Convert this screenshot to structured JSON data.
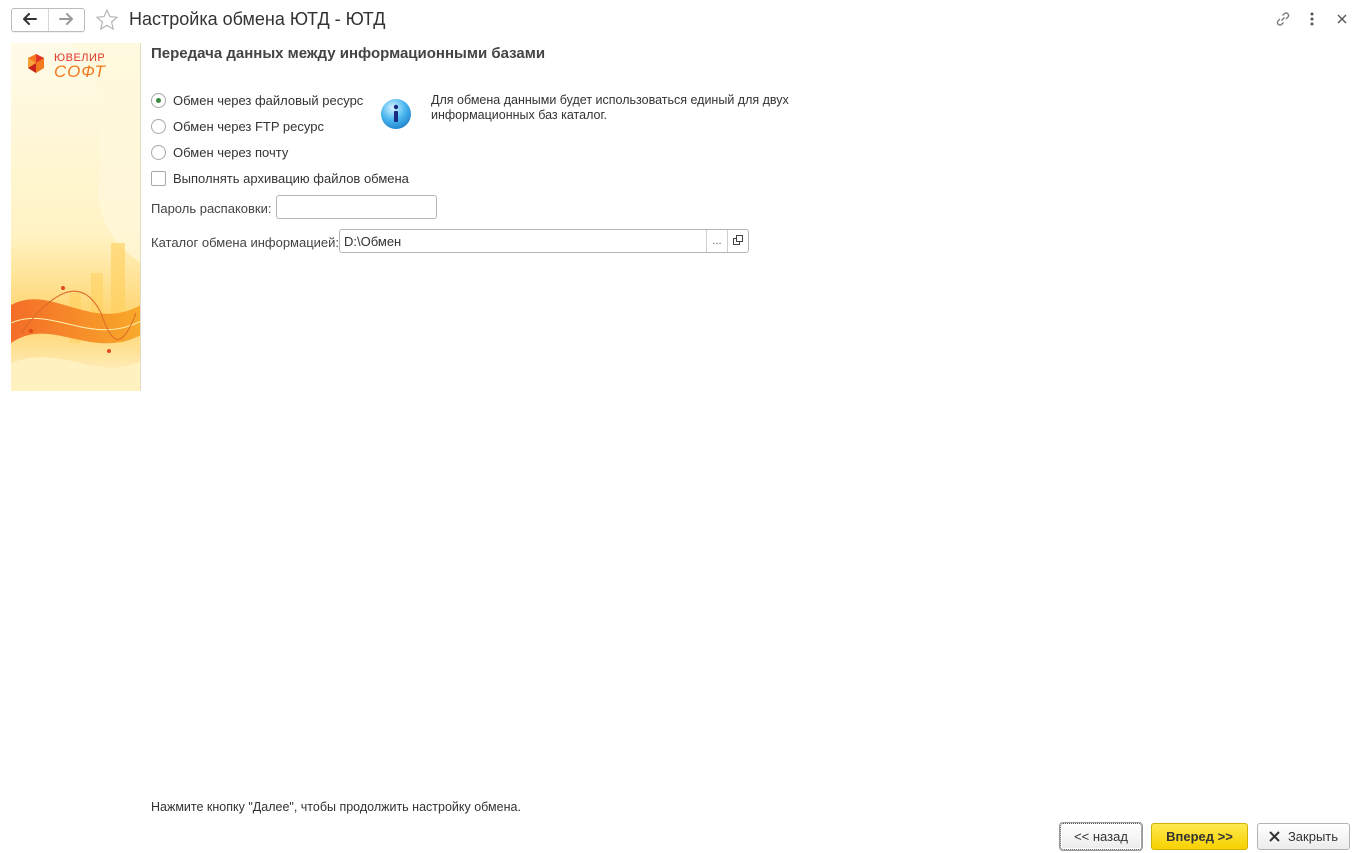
{
  "window": {
    "title": "Настройка обмена ЮТД - ЮТД",
    "nav_back_icon": "arrow-left-icon",
    "nav_forward_icon": "arrow-right-icon",
    "favorite_icon": "star-icon",
    "link_icon": "link-icon",
    "more_icon": "more-vertical-icon",
    "close_icon": "close-icon"
  },
  "banner": {
    "logo_line1": "ЮВЕЛИР",
    "logo_line2": "СОФТ",
    "accent_color": "#f47a20"
  },
  "form": {
    "heading": "Передача данных между информационными базами",
    "options": [
      {
        "label": "Обмен через файловый ресурс",
        "selected": true
      },
      {
        "label": "Обмен через FTP ресурс",
        "selected": false
      },
      {
        "label": "Обмен через почту",
        "selected": false
      }
    ],
    "archive_checkbox": {
      "label": "Выполнять архивацию файлов обмена",
      "checked": false
    },
    "info_text": "Для обмена данными будет использоваться единый для двух информационных баз каталог.",
    "password": {
      "label": "Пароль распаковки:",
      "value": ""
    },
    "catalog": {
      "label": "Каталог обмена информацией:",
      "value": "D:\\Обмен",
      "select_button": "...",
      "open_button_icon": "open-external-icon"
    }
  },
  "footer": {
    "hint": "Нажмите кнопку \"Далее\", чтобы продолжить настройку обмена.",
    "back_label": "<< назад",
    "next_label": "Вперед >>",
    "close_label": "Закрыть",
    "next_color": "#f7d100"
  }
}
